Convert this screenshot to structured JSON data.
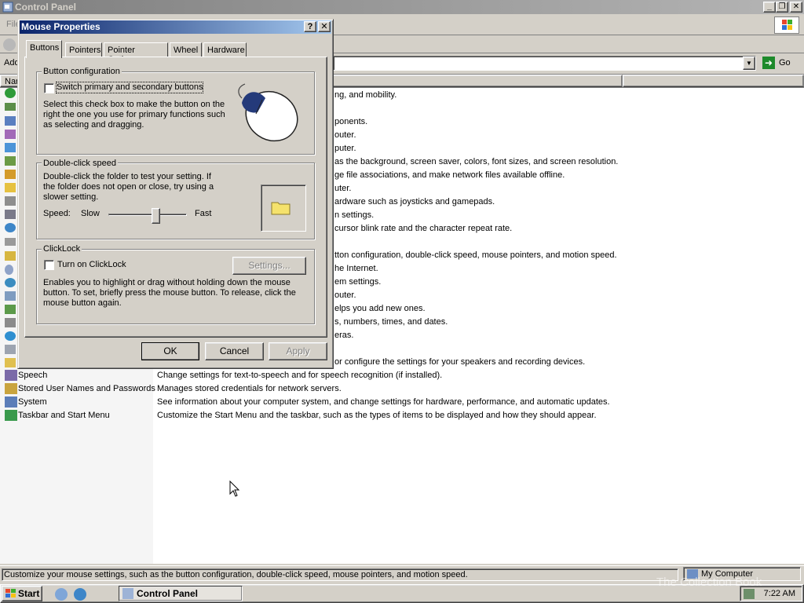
{
  "window": {
    "title": "Control Panel",
    "menu_first": "File",
    "address_label": "Address",
    "go_label": "Go",
    "column_name": "Name"
  },
  "control_panel": {
    "partial_descriptions": [
      "ng, and mobility.",
      "",
      "ponents.",
      "outer.",
      "puter.",
      "as the background, screen saver, colors, font sizes, and screen resolution.",
      "ge file associations, and make network files available offline.",
      "uter.",
      "ardware such as joysticks and gamepads.",
      "n settings.",
      "cursor blink rate and the character repeat rate.",
      "",
      "tton configuration, double-click speed, mouse pointers, and motion speed.",
      "he Internet.",
      "em settings.",
      "outer.",
      "elps you add new ones.",
      "s, numbers, times, and dates.",
      "eras.",
      "",
      "or configure the settings for your speakers and recording devices."
    ],
    "items": [
      {
        "name": "Speech",
        "description": "Change settings for text-to-speech and for speech recognition (if installed)."
      },
      {
        "name": "Stored User Names and Passwords",
        "description": "Manages stored credentials for network servers."
      },
      {
        "name": "System",
        "description": "See information about your computer system, and change settings for hardware, performance, and automatic updates."
      },
      {
        "name": "Taskbar and Start Menu",
        "description": "Customize the Start Menu and the taskbar, such as the types of items to be displayed and how they should appear."
      }
    ]
  },
  "status_bar": {
    "text": "Customize your mouse settings, such as the button configuration, double-click speed, mouse pointers, and motion speed.",
    "zone": "My Computer"
  },
  "taskbar": {
    "start_label": "Start",
    "task_label": "Control Panel",
    "clock": "7:22 AM"
  },
  "dialog": {
    "title": "Mouse Properties",
    "tabs": [
      "Buttons",
      "Pointers",
      "Pointer Options",
      "Wheel",
      "Hardware"
    ],
    "button_config": {
      "legend": "Button configuration",
      "checkbox_label": "Switch primary and secondary buttons",
      "description": "Select this check box to make the button on the right the one you use for primary functions such as selecting and dragging."
    },
    "double_click": {
      "legend": "Double-click speed",
      "description": "Double-click the folder to test your setting. If the folder does not open or close, try using a slower setting.",
      "speed_label": "Speed:",
      "slow": "Slow",
      "fast": "Fast",
      "speed_value": 0.6
    },
    "clicklock": {
      "legend": "ClickLock",
      "checkbox_label": "Turn on ClickLock",
      "settings_label": "Settings...",
      "description": "Enables you to highlight or drag without holding down the mouse button. To set, briefly press the mouse button. To release, click the mouse button again."
    },
    "ok_label": "OK",
    "cancel_label": "Cancel",
    "apply_label": "Apply"
  },
  "watermark": "The Collection Book"
}
